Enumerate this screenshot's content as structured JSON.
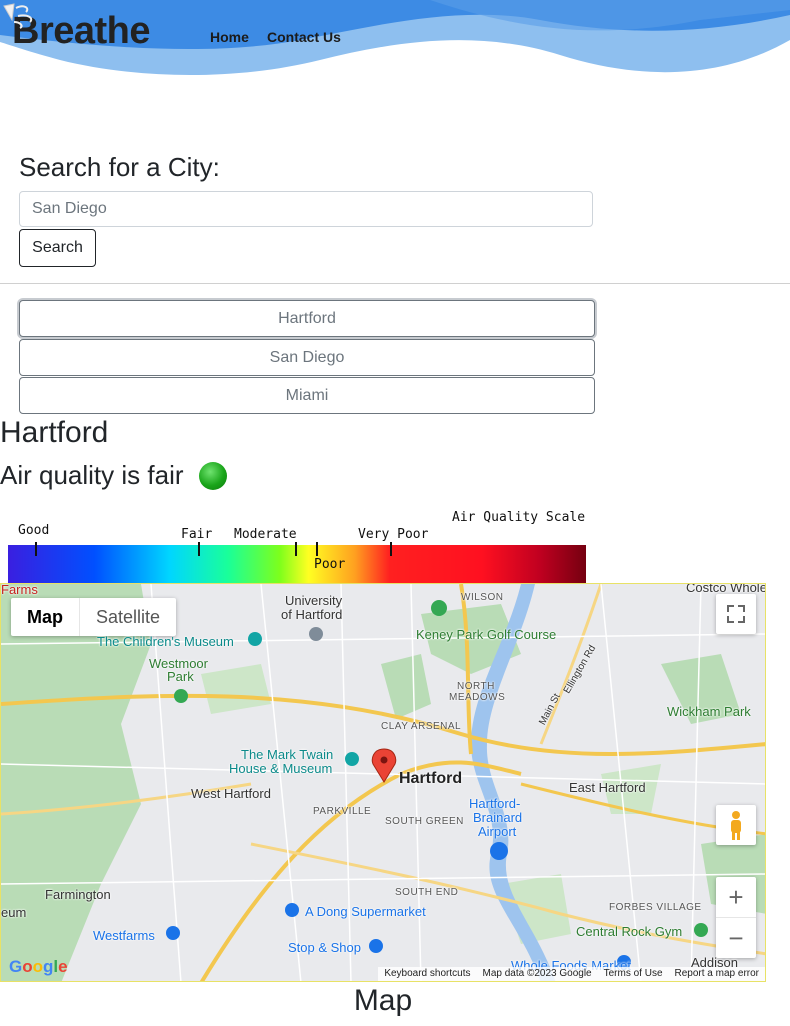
{
  "header": {
    "brand": "Breathe",
    "nav": [
      {
        "label": "Home"
      },
      {
        "label": "Contact Us"
      }
    ],
    "colors": {
      "wave_dark": "#3d8be4",
      "wave_light": "#8ebfef"
    }
  },
  "search": {
    "heading": "Search for a City:",
    "placeholder": "San Diego",
    "button": "Search"
  },
  "cities": [
    {
      "label": "Hartford",
      "active": true
    },
    {
      "label": "San Diego",
      "active": false
    },
    {
      "label": "Miami",
      "active": false
    }
  ],
  "current": {
    "city": "Hartford",
    "air_quality_text": "Air quality is fair",
    "indicator_color": "#1aa51a"
  },
  "scale": {
    "title": "Air Quality Scale",
    "levels": [
      "Good",
      "Fair",
      "Moderate",
      "Poor",
      "Very Poor"
    ]
  },
  "map": {
    "type_options": [
      "Map",
      "Satellite"
    ],
    "zoom_in": "+",
    "zoom_out": "−",
    "logo": "Google",
    "places": {
      "hartford": "Hartford",
      "west_hartford": "West Hartford",
      "east_hartford": "East Hartford",
      "farmington": "Farmington",
      "westfarms": "Westfarms",
      "wickham": "Wickham Park",
      "univ1": "University",
      "univ2": "of Hartford",
      "childrens": "The Children's Museum",
      "westmoor1": "Westmoor",
      "westmoor2": "Park",
      "keney": "Keney Park Golf Course",
      "twain1": "The Mark Twain",
      "twain2": "House & Museum",
      "brainard1": "Hartford-",
      "brainard2": "Brainard",
      "brainard3": "Airport",
      "adong": "A Dong Supermarket",
      "stopshop": "Stop & Shop",
      "wholefoods": "Whole Foods Market",
      "centralrock": "Central Rock Gym",
      "addison": "Addison",
      "costco": "Costco Whole",
      "farms": "Farms",
      "eum": "eum",
      "north_meadows1": "NORTH",
      "north_meadows2": "MEADOWS",
      "clay_arsenal": "CLAY ARSENAL",
      "parkville": "PARKVILLE",
      "south_green": "SOUTH GREEN",
      "south_end": "SOUTH END",
      "forbes": "FORBES VILLAGE",
      "wilson": "WILSON",
      "main_st": "Main St",
      "ellington": "Ellington Rd"
    },
    "attribution": [
      "Keyboard shortcuts",
      "Map data ©2023 Google",
      "Terms of Use",
      "Report a map error"
    ],
    "caption": "Map"
  }
}
